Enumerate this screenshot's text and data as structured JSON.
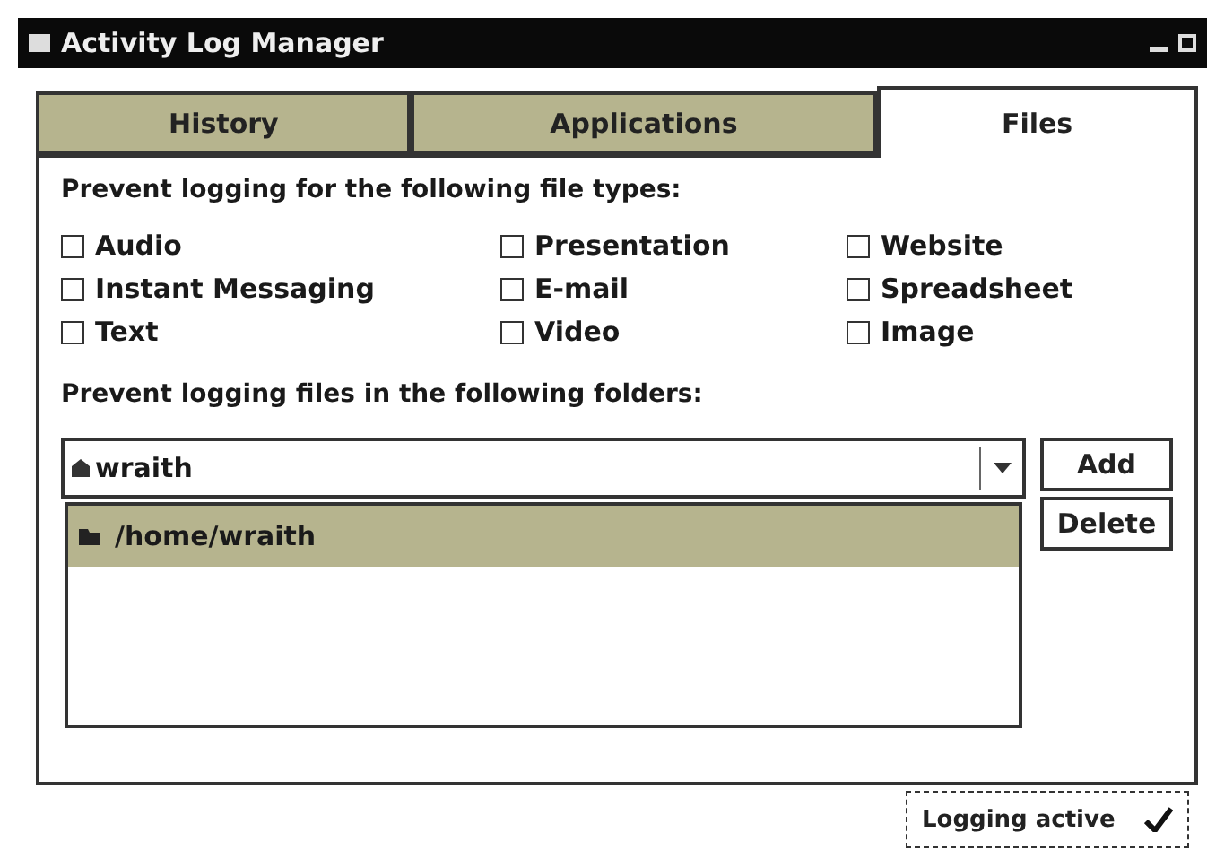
{
  "window": {
    "title": "Activity Log Manager"
  },
  "tabs": [
    {
      "label": "History",
      "selected": false
    },
    {
      "label": "Applications",
      "selected": false
    },
    {
      "label": "Files",
      "selected": true
    }
  ],
  "file_types": {
    "heading": "Prevent logging for the following file types:",
    "items": [
      {
        "label": "Audio",
        "checked": false
      },
      {
        "label": "Presentation",
        "checked": false
      },
      {
        "label": "Website",
        "checked": false
      },
      {
        "label": "Instant Messaging",
        "checked": false
      },
      {
        "label": "E-mail",
        "checked": false
      },
      {
        "label": "Spreadsheet",
        "checked": false
      },
      {
        "label": "Text",
        "checked": false
      },
      {
        "label": "Video",
        "checked": false
      },
      {
        "label": "Image",
        "checked": false
      }
    ]
  },
  "folders": {
    "heading": "Prevent logging files in the following folders:",
    "combo_value": "wraith",
    "items": [
      {
        "path": "/home/wraith",
        "selected": true
      }
    ],
    "buttons": [
      "Add",
      "Delete"
    ]
  },
  "status": {
    "label": "Logging active",
    "on": true
  }
}
